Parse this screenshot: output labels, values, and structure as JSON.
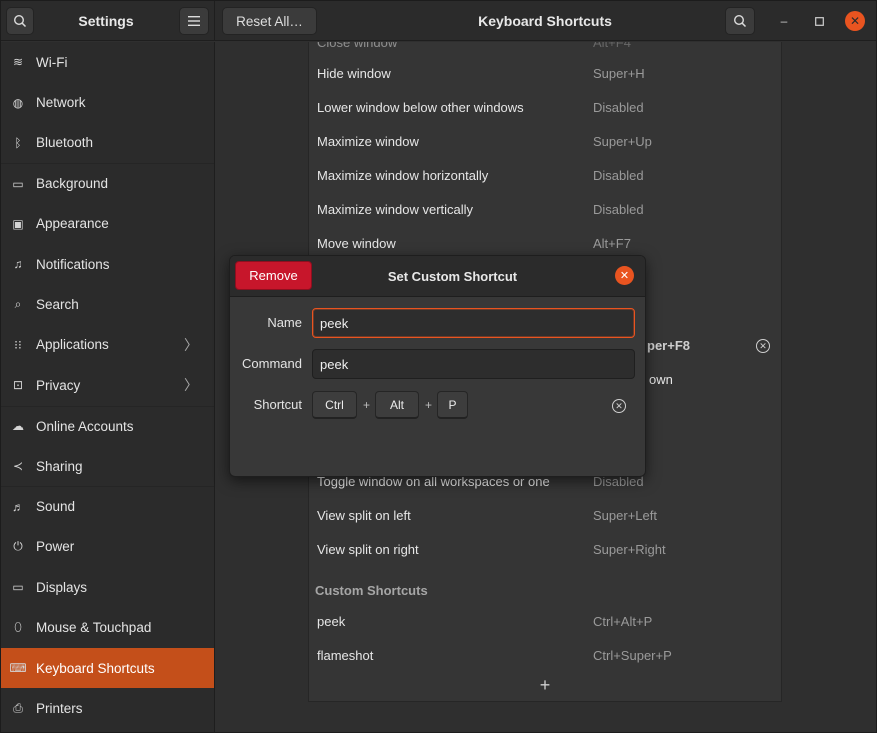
{
  "header": {
    "app_title": "Settings",
    "reset_label": "Reset All…",
    "panel_title": "Keyboard Shortcuts",
    "accent_color": "#e95420"
  },
  "sidebar": {
    "items": [
      {
        "label": "Wi-Fi",
        "icon": "wifi-icon",
        "glyph": "≋"
      },
      {
        "label": "Network",
        "icon": "network-icon",
        "glyph": "◍"
      },
      {
        "label": "Bluetooth",
        "icon": "bluetooth-icon",
        "glyph": "ᛒ"
      },
      {
        "label": "Background",
        "icon": "background-icon",
        "glyph": "▭"
      },
      {
        "label": "Appearance",
        "icon": "appearance-icon",
        "glyph": "▣"
      },
      {
        "label": "Notifications",
        "icon": "bell-icon",
        "glyph": "♫"
      },
      {
        "label": "Search",
        "icon": "search-icon",
        "glyph": "⌕"
      },
      {
        "label": "Applications",
        "icon": "grid-icon",
        "glyph": "⁝⁝"
      },
      {
        "label": "Privacy",
        "icon": "lock-icon",
        "glyph": "⊡"
      },
      {
        "label": "Online Accounts",
        "icon": "cloud-icon",
        "glyph": "☁"
      },
      {
        "label": "Sharing",
        "icon": "share-icon",
        "glyph": "≺"
      },
      {
        "label": "Sound",
        "icon": "music-icon",
        "glyph": "♬"
      },
      {
        "label": "Power",
        "icon": "power-icon",
        "glyph": "⏻"
      },
      {
        "label": "Displays",
        "icon": "display-icon",
        "glyph": "▭"
      },
      {
        "label": "Mouse & Touchpad",
        "icon": "mouse-icon",
        "glyph": "⬯"
      },
      {
        "label": "Keyboard Shortcuts",
        "icon": "keyboard-icon",
        "glyph": "⌨"
      },
      {
        "label": "Printers",
        "icon": "printer-icon",
        "glyph": "⎙"
      }
    ]
  },
  "shortcuts": {
    "rows": [
      {
        "name": "Hide window",
        "shortcut": "Super+H"
      },
      {
        "name": "Lower window below other windows",
        "shortcut": "Disabled"
      },
      {
        "name": "Maximize window",
        "shortcut": "Super+Up"
      },
      {
        "name": "Maximize window horizontally",
        "shortcut": "Disabled"
      },
      {
        "name": "Maximize window vertically",
        "shortcut": "Disabled"
      },
      {
        "name": "Move window",
        "shortcut": "Alt+F7"
      }
    ],
    "partial_shortcut_1": "per+F8",
    "partial_shortcut_2": "own",
    "rows_after": [
      {
        "name": "Toggle window on all workspaces or one",
        "shortcut": "Disabled"
      },
      {
        "name": "View split on left",
        "shortcut": "Super+Left"
      },
      {
        "name": "View split on right",
        "shortcut": "Super+Right"
      }
    ],
    "custom_header": "Custom Shortcuts",
    "custom_rows": [
      {
        "name": "peek",
        "shortcut": "Ctrl+Alt+P"
      },
      {
        "name": "flameshot",
        "shortcut": "Ctrl+Super+P"
      }
    ],
    "add_label": "+"
  },
  "dialog": {
    "remove_label": "Remove",
    "title": "Set Custom Shortcut",
    "name_label": "Name",
    "name_value": "peek",
    "command_label": "Command",
    "command_value": "peek",
    "shortcut_label": "Shortcut",
    "keys": [
      "Ctrl",
      "Alt",
      "P"
    ],
    "plus": "+"
  }
}
